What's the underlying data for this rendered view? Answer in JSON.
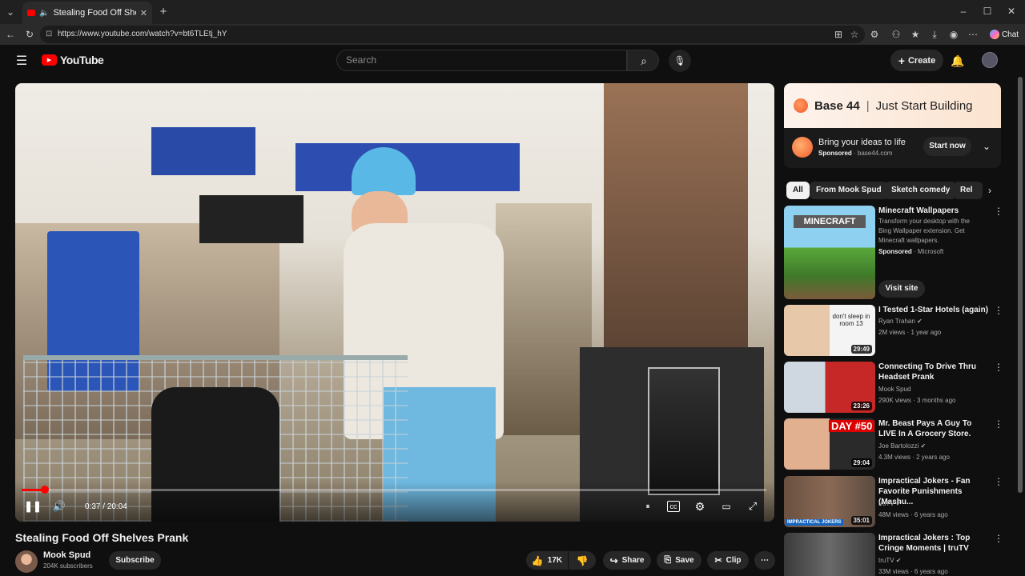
{
  "browser": {
    "tab_title": "Stealing Food Off Shelves Prank",
    "url": "https://www.youtube.com/watch?v=bt6TLEtj_hY",
    "chat_label": "Chat"
  },
  "header": {
    "logo_text": "YouTube",
    "search_placeholder": "Search",
    "create_label": "Create"
  },
  "player": {
    "current_time": "0:37",
    "duration": "20:04",
    "time_text": "0:37 / 20:04",
    "progress_fraction": 0.031
  },
  "video": {
    "title": "Stealing Food Off Shelves Prank",
    "channel": "Mook Spud",
    "subscribers": "204K subscribers",
    "subscribe_label": "Subscribe",
    "likes": "17K",
    "share_label": "Share",
    "save_label": "Save",
    "clip_label": "Clip"
  },
  "ad": {
    "banner_brand": "Base 44",
    "banner_sep": "|",
    "banner_tagline": "Just Start Building",
    "headline": "Bring your ideas to life",
    "sponsored": "Sponsored",
    "domain": "base44.com",
    "cta": "Start now"
  },
  "chips": [
    "All",
    "From Mook Spud",
    "Sketch comedy",
    "Rel"
  ],
  "recommendations": [
    {
      "title": "Minecraft Wallpapers",
      "desc": "Transform your desktop with the Bing Wallpaper extension. Get Minecraft wallpapers.",
      "sponsored": "Sponsored",
      "advertiser": "Microsoft",
      "cta": "Visit site",
      "thumb_text": "MINECRAFT"
    },
    {
      "title": "I Tested 1-Star Hotels (again)",
      "channel": "Ryan Trahan",
      "meta": "2M views · 1 year ago",
      "duration": "29:49",
      "thumb_text": "don't sleep in room 13"
    },
    {
      "title": "Connecting To Drive Thru Headset Prank",
      "channel": "Mook Spud",
      "meta": "290K views · 3 months ago",
      "duration": "23:26"
    },
    {
      "title": "Mr. Beast Pays A Guy To LIVE In A Grocery Store.",
      "channel": "Joe Bartolozzi",
      "meta": "4.3M views · 2 years ago",
      "duration": "29:04",
      "thumb_text": "DAY #50"
    },
    {
      "title": "Impractical Jokers - Fan Favorite Punishments (Mashu...",
      "channel": "truTV",
      "meta": "48M views · 6 years ago",
      "duration": "35:01",
      "thumb_text": "IMPRACTICAL JOKERS"
    },
    {
      "title": "Impractical Jokers : Top Cringe Moments | truTV",
      "channel": "truTV",
      "meta": "33M views · 6 years ago"
    }
  ],
  "colors": {
    "accent": "#ff0000",
    "background": "#0f0f0f"
  }
}
